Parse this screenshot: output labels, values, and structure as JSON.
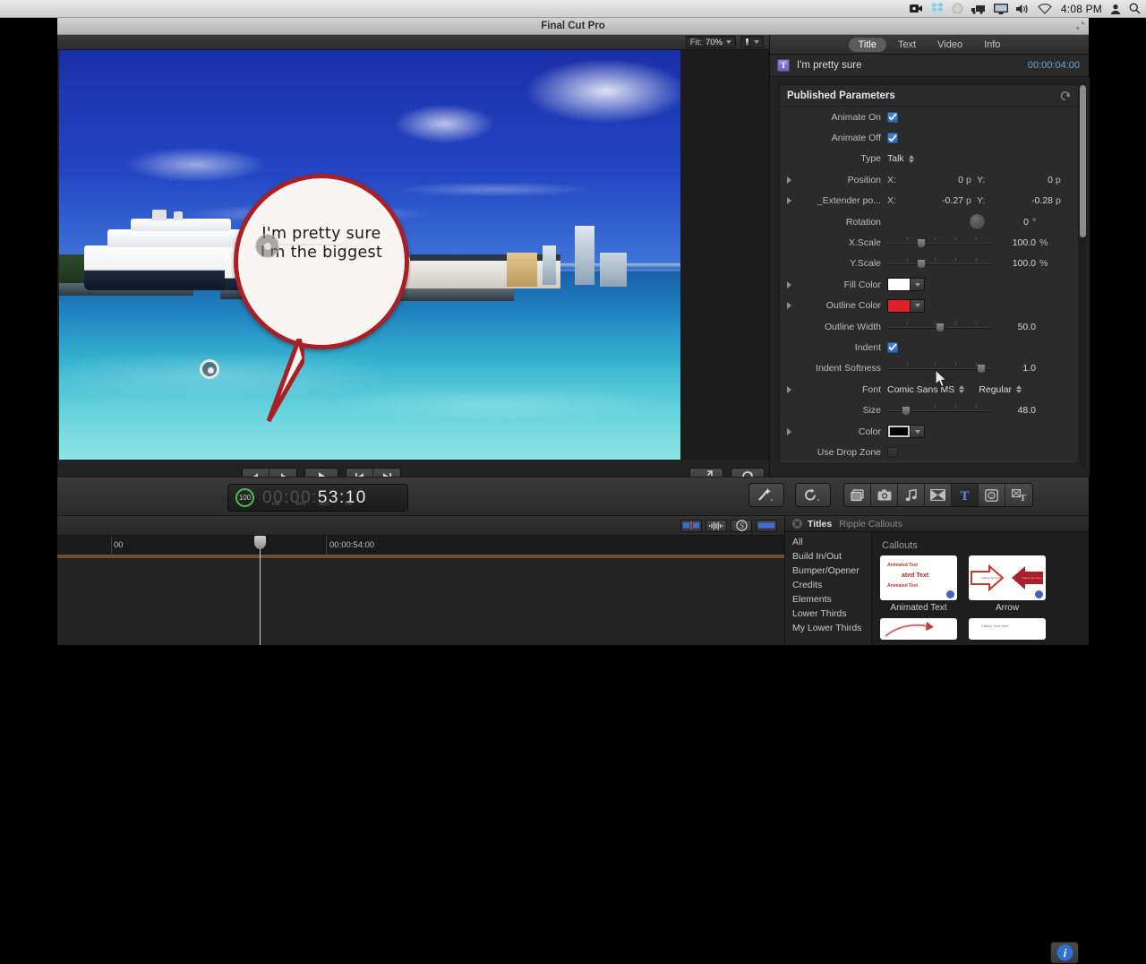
{
  "menubar": {
    "time": "4:08 PM",
    "icons": [
      "screen-record-icon",
      "dropbox-icon",
      "circle-icon",
      "truck-icon",
      "display-icon",
      "volume-icon",
      "wifi-icon",
      "user-icon",
      "spotlight-search-icon"
    ]
  },
  "window": {
    "title": "Final Cut Pro"
  },
  "viewer": {
    "fit_label": "Fit:",
    "zoom_value": "70%",
    "bubble_line1": "I'm pretty sure",
    "bubble_line2": "I'm the biggest",
    "bubble_fill": "#f7f4f1",
    "bubble_outline": "#a81f26"
  },
  "playback": {
    "step_back": "step-backward",
    "step_forward": "step-forward",
    "play": "play",
    "go_start": "go-to-start",
    "go_end": "go-to-end",
    "fullscreen": "fullscreen",
    "loop": "loop"
  },
  "inspector": {
    "tabs": [
      {
        "label": "Title",
        "active": true
      },
      {
        "label": "Text",
        "active": false
      },
      {
        "label": "Video",
        "active": false
      },
      {
        "label": "Info",
        "active": false
      }
    ],
    "clip_name": "I'm pretty sure",
    "clip_badge": "T",
    "duration": "00:00:04:00",
    "group_title": "Published Parameters",
    "params": [
      {
        "label": "Animate On",
        "type": "checkbox",
        "checked": true
      },
      {
        "label": "Animate Off",
        "type": "checkbox",
        "checked": true
      },
      {
        "label": "Type",
        "type": "popup",
        "value": "Talk"
      },
      {
        "label": "Position",
        "type": "xy",
        "disclosure": true,
        "x_label": "X:",
        "x_value": "0",
        "x_unit": "p",
        "y_label": "Y:",
        "y_value": "0",
        "y_unit": "p"
      },
      {
        "label": "_Extender po...",
        "type": "xy",
        "disclosure": true,
        "x_label": "X:",
        "x_value": "-0.27",
        "x_unit": "p",
        "y_label": "Y:",
        "y_value": "-0.28",
        "y_unit": "p"
      },
      {
        "label": "Rotation",
        "type": "dial",
        "value": "0",
        "unit": "°"
      },
      {
        "label": "X.Scale",
        "type": "slider",
        "value": "100.0",
        "unit": "%",
        "pos": 0.32
      },
      {
        "label": "Y.Scale",
        "type": "slider",
        "value": "100.0",
        "unit": "%",
        "pos": 0.32
      },
      {
        "label": "Fill Color",
        "type": "color",
        "disclosure": true,
        "swatch": "#ffffff"
      },
      {
        "label": "Outline Color",
        "type": "color",
        "disclosure": true,
        "swatch": "#e01f26"
      },
      {
        "label": "Outline Width",
        "type": "slider",
        "value": "50.0",
        "unit": "",
        "pos": 0.5
      },
      {
        "label": "Indent",
        "type": "checkbox",
        "checked": true
      },
      {
        "label": "Indent Softness",
        "type": "slider",
        "value": "1.0",
        "unit": "",
        "pos": 0.92
      },
      {
        "label": "Font",
        "type": "font",
        "value": "Comic Sans MS",
        "style": "Regular",
        "disclosure": true
      },
      {
        "label": "Size",
        "type": "slider",
        "value": "48.0",
        "unit": "",
        "pos": 0.17
      },
      {
        "label": "Color",
        "type": "color",
        "disclosure": true,
        "swatch": "#000000"
      },
      {
        "label": "Use Drop Zone",
        "type": "checkbox",
        "checked": false
      }
    ]
  },
  "toolbar": {
    "timecode": "00:00:53:10",
    "timecode_dim": "00:00:",
    "timecode_bright": "53:10",
    "units": [
      "HR",
      "MIN",
      "SEC",
      "FR"
    ],
    "percent": "100",
    "buttons": [
      {
        "name": "magic-wand-tool",
        "active": false
      },
      {
        "name": "retime-tool",
        "active": false
      },
      {
        "name": "photos-browser",
        "active": false
      },
      {
        "name": "camera-browser",
        "active": false
      },
      {
        "name": "music-browser",
        "active": false
      },
      {
        "name": "transitions-browser",
        "active": false
      },
      {
        "name": "titles-browser",
        "active": true
      },
      {
        "name": "generators-browser",
        "active": false
      },
      {
        "name": "effects-browser",
        "active": false
      }
    ],
    "info_button": "inspector-toggle"
  },
  "timeline": {
    "ruler_left_label": "00",
    "ruler_label": "00:00:54:00",
    "icons": [
      "markers-icon",
      "audio-waveform-icon",
      "solo-icon",
      "clip-appearance-icon"
    ]
  },
  "browser": {
    "title": "Titles",
    "subtitle": "Ripple Callouts",
    "categories": [
      "All",
      "Build In/Out",
      "Bumper/Opener",
      "Credits",
      "Elements",
      "Lower Thirds",
      "My Lower Thirds"
    ],
    "section": "Callouts",
    "items": [
      {
        "label": "Animated Text"
      },
      {
        "label": "Arrow"
      }
    ]
  }
}
